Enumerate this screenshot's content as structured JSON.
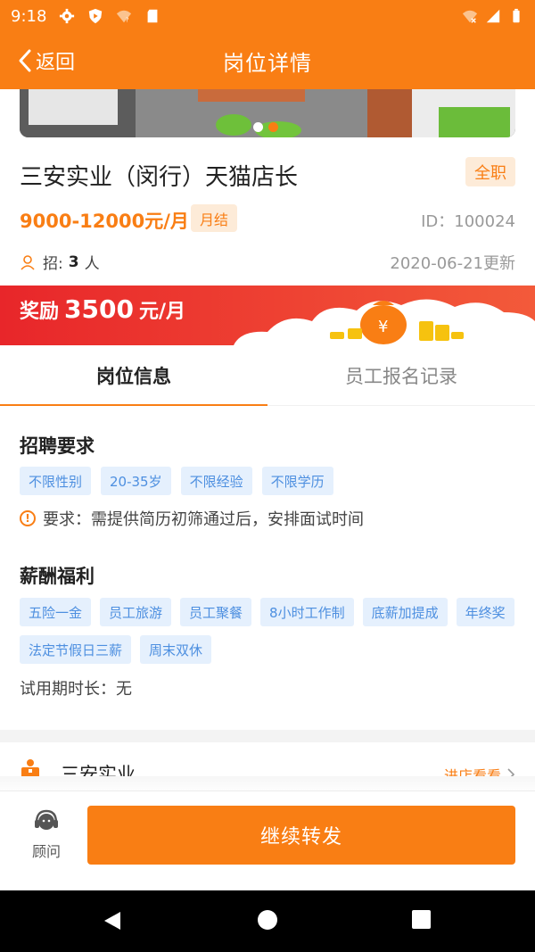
{
  "status_bar": {
    "time": "9:18",
    "icons": [
      "gear-icon",
      "shield-icon",
      "wifi-unknown-icon",
      "sd-card-icon",
      "wifi-icon",
      "signal-icon",
      "battery-icon"
    ]
  },
  "header": {
    "back_label": "返回",
    "title": "岗位详情"
  },
  "job": {
    "title": "三安实业（闵行）天猫店长",
    "type": "全职",
    "salary": "9000-12000元/月",
    "pay_cycle": "月结",
    "id_text": "ID：100024",
    "recruit_label": "招:",
    "recruit_count": "3",
    "recruit_unit": "人",
    "updated": "2020-06-21更新"
  },
  "reward": {
    "label": "奖励",
    "amount": "3500",
    "unit": "元/月"
  },
  "tabs": [
    {
      "label": "岗位信息",
      "active": true
    },
    {
      "label": "员工报名记录",
      "active": false
    }
  ],
  "requirements": {
    "title": "招聘要求",
    "tags": [
      "不限性别",
      "20-35岁",
      "不限经验",
      "不限学历"
    ],
    "note": "要求：需提供简历初筛通过后，安排面试时间"
  },
  "benefits": {
    "title": "薪酬福利",
    "tags_row1": [
      "五险一金",
      "员工旅游",
      "员工聚餐",
      "8小时工作制",
      "底薪加提成",
      "年终奖"
    ],
    "tags_row2": [
      "法定节假日三薪",
      "周末双休"
    ],
    "trial": "试用期时长：无"
  },
  "company": {
    "name": "三安实业",
    "enter_label": "进店看看"
  },
  "bottom": {
    "advisor_label": "顾问",
    "forward_label": "继续转发"
  },
  "colors": {
    "brand": "#f97e14",
    "reward_red": "#ec3a30",
    "tag_blue": "#4d8fe0",
    "tag_bg": "#e5f0fd"
  }
}
